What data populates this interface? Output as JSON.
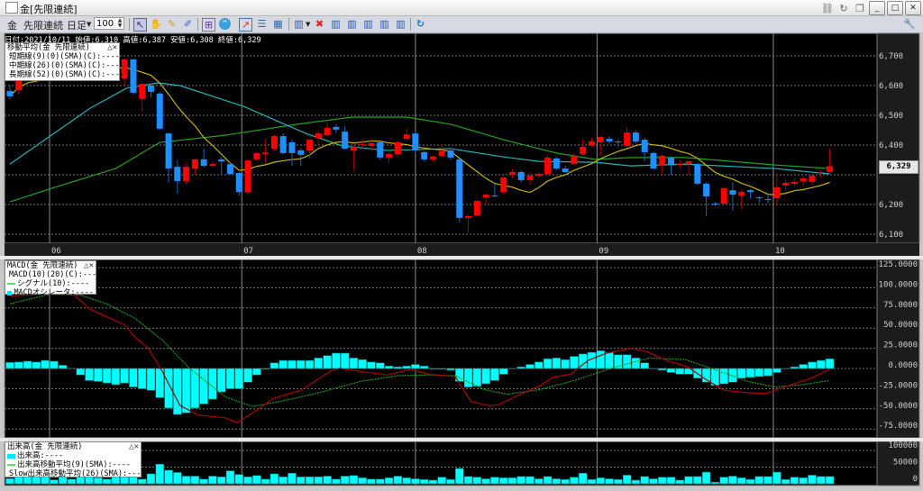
{
  "window": {
    "title": "金[先限連続]"
  },
  "toolbar": {
    "symbol": "金",
    "contract": "先限連続",
    "period": "日足",
    "count": "100"
  },
  "info": {
    "text": "日付:2021/10/11 始値:6,310 高値:6,387 安値:6,308 終値:6,329"
  },
  "current_price": "6,329",
  "price_legend": {
    "title": "移動平均(金 先限連続)",
    "items": [
      "短期線(9)(0)(SMA)(C):----",
      "中期線(26)(0)(SMA)(C):----",
      "長期線(52)(0)(SMA)(C):----"
    ]
  },
  "macd_legend": {
    "title": "MACD(金 先限連続)",
    "items": [
      "MACD(10)(20)(C):----",
      "シグナル(10):----",
      "MACDオシレータ:----"
    ]
  },
  "volume_legend": {
    "title": "出来高(金 先限連続)",
    "items": [
      "出来高:----",
      "出来高移動平均(9)(SMA):----",
      "Slow出来高移動平均(26)(SMA):----"
    ]
  },
  "colors": {
    "up": "#ff0000",
    "down": "#1e8fff",
    "ma_short": "#c8b400",
    "ma_mid": "#20b4b4",
    "ma_long": "#22a322",
    "macd": "#b00000",
    "signal": "#1a9a1a",
    "hist": "#00ffff"
  },
  "chart_data": {
    "type": "candlestick",
    "x_labels": [
      {
        "label": "06",
        "index": 4.5
      },
      {
        "label": "07",
        "index": 26.3
      },
      {
        "label": "08",
        "index": 46
      },
      {
        "label": "09",
        "index": 66.6
      },
      {
        "label": "10",
        "index": 86.6
      }
    ],
    "price_axis": {
      "ticks": [
        6700,
        6600,
        6500,
        6400,
        6200,
        6100
      ],
      "labels": [
        "6,700",
        "6,600",
        "6,500",
        "6,400",
        "6,200",
        "6,100"
      ],
      "grid": [
        6700,
        6600,
        6500,
        6400,
        6300,
        6200,
        6100
      ]
    },
    "ohlc": [
      [
        6582,
        6600,
        6555,
        6564
      ],
      [
        6585,
        6630,
        6570,
        6624
      ],
      [
        6624,
        6648,
        6615,
        6640
      ],
      [
        6640,
        6650,
        6622,
        6630
      ],
      [
        6630,
        6668,
        6625,
        6660
      ],
      [
        6660,
        6672,
        6640,
        6650
      ],
      [
        6650,
        6690,
        6645,
        6680
      ],
      [
        6680,
        6688,
        6660,
        6670
      ],
      [
        6670,
        6698,
        6662,
        6690
      ],
      [
        6690,
        6695,
        6652,
        6660
      ],
      [
        6660,
        6668,
        6640,
        6650
      ],
      [
        6650,
        6658,
        6630,
        6640
      ],
      [
        6640,
        6648,
        6615,
        6624
      ],
      [
        6624,
        6692,
        6600,
        6688
      ],
      [
        6688,
        6690,
        6570,
        6576
      ],
      [
        6555,
        6610,
        6510,
        6606
      ],
      [
        6600,
        6605,
        6560,
        6579
      ],
      [
        6573,
        6578,
        6450,
        6455
      ],
      [
        6439,
        6442,
        6273,
        6321
      ],
      [
        6327,
        6348,
        6236,
        6279
      ],
      [
        6279,
        6340,
        6270,
        6327
      ],
      [
        6321,
        6355,
        6300,
        6352
      ],
      [
        6352,
        6388,
        6325,
        6330
      ],
      [
        6330,
        6345,
        6325,
        6336
      ],
      [
        6352,
        6360,
        6300,
        6345
      ],
      [
        6336,
        6340,
        6300,
        6303
      ],
      [
        6306,
        6310,
        6230,
        6242
      ],
      [
        6242,
        6352,
        6232,
        6348
      ],
      [
        6352,
        6378,
        6348,
        6373
      ],
      [
        6370,
        6420,
        6340,
        6375
      ],
      [
        6388,
        6435,
        6380,
        6430
      ],
      [
        6430,
        6440,
        6368,
        6373
      ],
      [
        6409,
        6418,
        6330,
        6373
      ],
      [
        6382,
        6390,
        6330,
        6367
      ],
      [
        6382,
        6420,
        6355,
        6418
      ],
      [
        6424,
        6448,
        6400,
        6439
      ],
      [
        6433,
        6475,
        6428,
        6458
      ],
      [
        6461,
        6470,
        6440,
        6452
      ],
      [
        6445,
        6465,
        6385,
        6388
      ],
      [
        6382,
        6400,
        6315,
        6394
      ],
      [
        6400,
        6420,
        6385,
        6402
      ],
      [
        6397,
        6420,
        6380,
        6406
      ],
      [
        6409,
        6412,
        6350,
        6358
      ],
      [
        6358,
        6375,
        6340,
        6370
      ],
      [
        6370,
        6415,
        6360,
        6409
      ],
      [
        6421,
        6455,
        6415,
        6436
      ],
      [
        6439,
        6442,
        6375,
        6382
      ],
      [
        6376,
        6380,
        6345,
        6352
      ],
      [
        6352,
        6365,
        6345,
        6361
      ],
      [
        6364,
        6400,
        6360,
        6379
      ],
      [
        6382,
        6385,
        6350,
        6358
      ],
      [
        6352,
        6355,
        6140,
        6155
      ],
      [
        6155,
        6165,
        6106,
        6161
      ],
      [
        6164,
        6215,
        6160,
        6212
      ],
      [
        6224,
        6238,
        6200,
        6233
      ],
      [
        6230,
        6270,
        6225,
        6227
      ],
      [
        6242,
        6295,
        6235,
        6291
      ],
      [
        6300,
        6320,
        6290,
        6309
      ],
      [
        6309,
        6315,
        6275,
        6282
      ],
      [
        6282,
        6310,
        6265,
        6297
      ],
      [
        6297,
        6310,
        6290,
        6303
      ],
      [
        6303,
        6365,
        6300,
        6358
      ],
      [
        6355,
        6360,
        6315,
        6321
      ],
      [
        6321,
        6330,
        6305,
        6309
      ],
      [
        6336,
        6370,
        6330,
        6364
      ],
      [
        6370,
        6420,
        6365,
        6394
      ],
      [
        6400,
        6425,
        6395,
        6412
      ],
      [
        6409,
        6432,
        6365,
        6427
      ],
      [
        6421,
        6430,
        6405,
        6412
      ],
      [
        6412,
        6420,
        6395,
        6410
      ],
      [
        6397,
        6460,
        6392,
        6442
      ],
      [
        6442,
        6450,
        6405,
        6412
      ],
      [
        6418,
        6425,
        6345,
        6376
      ],
      [
        6373,
        6378,
        6318,
        6321
      ],
      [
        6330,
        6368,
        6300,
        6364
      ],
      [
        6358,
        6362,
        6300,
        6336
      ],
      [
        6333,
        6350,
        6325,
        6336
      ],
      [
        6336,
        6350,
        6300,
        6345
      ],
      [
        6336,
        6340,
        6265,
        6270
      ],
      [
        6270,
        6275,
        6160,
        6227
      ],
      [
        6203,
        6210,
        6195,
        6200
      ],
      [
        6203,
        6260,
        6200,
        6255
      ],
      [
        6248,
        6275,
        6180,
        6233
      ],
      [
        6230,
        6250,
        6185,
        6242
      ],
      [
        6248,
        6252,
        6220,
        6242
      ],
      [
        6224,
        6228,
        6205,
        6222
      ],
      [
        6218,
        6238,
        6205,
        6216
      ],
      [
        6221,
        6300,
        6200,
        6258
      ],
      [
        6264,
        6285,
        6250,
        6273
      ],
      [
        6270,
        6288,
        6260,
        6276
      ],
      [
        6279,
        6295,
        6262,
        6288
      ],
      [
        6276,
        6305,
        6265,
        6297
      ],
      [
        6307,
        6318,
        6290,
        6309
      ],
      [
        6310,
        6387,
        6308,
        6329
      ]
    ],
    "ma_mid": [
      [
        0,
        6336
      ],
      [
        4.7,
        6433
      ],
      [
        9.1,
        6524
      ],
      [
        13.2,
        6591
      ],
      [
        16.8,
        6609
      ],
      [
        19.3,
        6600
      ],
      [
        26.5,
        6530
      ],
      [
        33.6,
        6439
      ],
      [
        37.7,
        6397
      ],
      [
        42.8,
        6382
      ],
      [
        50,
        6388
      ],
      [
        56,
        6360
      ],
      [
        60,
        6345
      ],
      [
        66.4,
        6342
      ],
      [
        70.4,
        6330
      ],
      [
        76.6,
        6336
      ],
      [
        86.8,
        6321
      ],
      [
        93,
        6303
      ]
    ],
    "ma_long": [
      [
        0,
        6209
      ],
      [
        5,
        6257
      ],
      [
        12,
        6321
      ],
      [
        17,
        6409
      ],
      [
        24.4,
        6433
      ],
      [
        32.6,
        6470
      ],
      [
        38.8,
        6494
      ],
      [
        45,
        6494
      ],
      [
        50,
        6470
      ],
      [
        56,
        6418
      ],
      [
        62,
        6373
      ],
      [
        66.4,
        6352
      ],
      [
        70.4,
        6358
      ],
      [
        76.6,
        6358
      ],
      [
        86.8,
        6333
      ],
      [
        93,
        6321
      ]
    ],
    "ma_short_period": 9,
    "macd_axis": {
      "ticks": [
        125,
        100,
        75,
        50,
        25,
        0,
        -25,
        -50,
        -75
      ],
      "labels": [
        "125.0000",
        "100.0000",
        "75.0000",
        "50.0000",
        "25.0000",
        "0.0000",
        "-25.0000",
        "-50.0000",
        "-75.0000"
      ]
    },
    "macd_hist": [
      7.5,
      8,
      9,
      8,
      10,
      9,
      4,
      0,
      -8,
      -15,
      -16,
      -18,
      -20,
      -18,
      -23,
      -25,
      -27,
      -36,
      -49,
      -57,
      -55,
      -49,
      -44,
      -38,
      -29,
      -25,
      -25,
      -17,
      -8,
      -1,
      7,
      10,
      10,
      10,
      10,
      13,
      16,
      19,
      19,
      13,
      11,
      8,
      7,
      3,
      2,
      3,
      5,
      3,
      -1,
      -1,
      -2,
      -16,
      -23,
      -22,
      -19,
      -15,
      -7,
      0,
      2,
      5,
      8,
      12,
      13,
      11,
      15,
      18,
      20,
      22,
      20,
      17,
      17,
      13,
      7,
      0,
      -2,
      -5,
      -7,
      -7,
      -12,
      -17,
      -21,
      -19,
      -17,
      -12,
      -11,
      -10,
      -9,
      -5,
      0,
      2,
      5,
      8,
      10,
      12
    ],
    "macd_line": [
      [
        0,
        90
      ],
      [
        7,
        94
      ],
      [
        9,
        74
      ],
      [
        11,
        64
      ],
      [
        13,
        54
      ],
      [
        14.2,
        39
      ],
      [
        15.7,
        25
      ],
      [
        17.3,
        -4
      ],
      [
        19.3,
        -46
      ],
      [
        21.4,
        -58
      ],
      [
        24.4,
        -61
      ],
      [
        25.8,
        -67
      ],
      [
        27.8,
        -53
      ],
      [
        29.9,
        -37
      ],
      [
        33,
        -27
      ],
      [
        36.4,
        -3
      ],
      [
        37.4,
        0
      ],
      [
        40,
        -4
      ],
      [
        42.8,
        -8
      ],
      [
        45.6,
        -1
      ],
      [
        47.4,
        -7
      ],
      [
        50.5,
        -10
      ],
      [
        52.3,
        -41
      ],
      [
        54.4,
        -46
      ],
      [
        55.4,
        -45
      ],
      [
        57.5,
        -34
      ],
      [
        60.2,
        -21
      ],
      [
        61.6,
        -11
      ],
      [
        63.6,
        -7
      ],
      [
        65.6,
        10
      ],
      [
        67.7,
        19
      ],
      [
        70.5,
        25
      ],
      [
        72.2,
        21
      ],
      [
        74.5,
        10
      ],
      [
        76.9,
        2
      ],
      [
        79,
        -14
      ],
      [
        81,
        -27
      ],
      [
        83.7,
        -30
      ],
      [
        85.8,
        -31
      ],
      [
        88.1,
        -22
      ],
      [
        90.9,
        -12
      ],
      [
        93,
        -1
      ]
    ],
    "signal_line": [
      [
        0,
        80
      ],
      [
        4.5,
        92
      ],
      [
        8,
        91
      ],
      [
        11,
        80
      ],
      [
        14.2,
        62
      ],
      [
        17.3,
        35
      ],
      [
        20.3,
        1
      ],
      [
        24.4,
        -35
      ],
      [
        27.5,
        -47
      ],
      [
        30.6,
        -41
      ],
      [
        34.7,
        -31
      ],
      [
        39.8,
        -16
      ],
      [
        43.9,
        -9
      ],
      [
        47.4,
        -8
      ],
      [
        50.5,
        -9
      ],
      [
        53.8,
        -26
      ],
      [
        56.4,
        -32
      ],
      [
        60.2,
        -26
      ],
      [
        64.3,
        -14
      ],
      [
        68.4,
        1
      ],
      [
        72.5,
        13
      ],
      [
        76.6,
        11
      ],
      [
        79.6,
        0
      ],
      [
        83.7,
        -16
      ],
      [
        86.8,
        -23
      ],
      [
        89.9,
        -20
      ],
      [
        93,
        -15
      ]
    ],
    "volume_axis": {
      "ticks": [
        100000,
        50000,
        0
      ],
      "labels": [
        "100000",
        "50000",
        "0"
      ]
    },
    "volume": [
      16000,
      21000,
      21000,
      21000,
      21000,
      12000,
      21000,
      14000,
      21000,
      21000,
      18000,
      14000,
      21000,
      21000,
      36000,
      14000,
      30000,
      59000,
      41000,
      34000,
      23000,
      23000,
      14000,
      23000,
      21000,
      39000,
      28000,
      21000,
      25000,
      14000,
      30000,
      21000,
      32000,
      21000,
      21000,
      21000,
      23000,
      14000,
      23000,
      25000,
      18000,
      14000,
      14000,
      18000,
      23000,
      18000,
      15000,
      13000,
      11000,
      20000,
      13000,
      46000,
      22000,
      20000,
      15000,
      20000,
      18000,
      18000,
      22000,
      22000,
      15000,
      22000,
      15000,
      13000,
      20000,
      32000,
      13000,
      18000,
      15000,
      13000,
      26000,
      11000,
      22000,
      15000,
      20000,
      20000,
      11000,
      22000,
      22000,
      35000,
      5000,
      20000,
      23000,
      18000,
      13000,
      22000,
      22000,
      35000,
      13000,
      20000,
      18000,
      26000,
      22000,
      22000
    ]
  }
}
